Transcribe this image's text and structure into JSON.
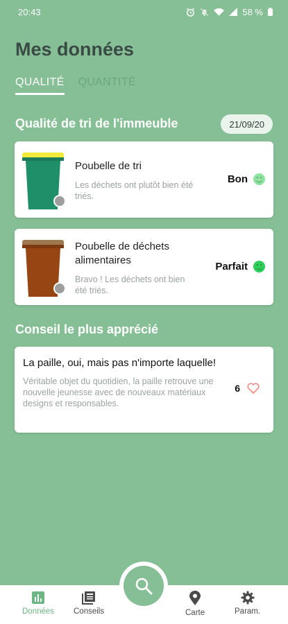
{
  "status_bar": {
    "time": "20:43",
    "battery": "58 %"
  },
  "header": {
    "title": "Mes données"
  },
  "tabs": [
    {
      "label": "QUALITÉ",
      "active": true
    },
    {
      "label": "QUANTITÉ",
      "active": false
    }
  ],
  "quality": {
    "title": "Qualité de tri de l'immeuble",
    "date": "21/09/20",
    "bins": [
      {
        "name": "Poubelle de tri",
        "description": "Les déchets ont plutôt bien été triés.",
        "rating": "Bon",
        "lid_color": "#f2ea3a",
        "body_color": "#1f8f6a",
        "face_color": "#8fe3a0"
      },
      {
        "name": "Poubelle de déchets alimentaires",
        "description": "Bravo ! Les déchets ont bien été triés.",
        "rating": "Parfait",
        "lid_color": "#a07850",
        "body_color": "#964513",
        "face_color": "#2ecc5a"
      }
    ]
  },
  "advice": {
    "title": "Conseil le plus apprécié",
    "tip_title": "La paille, oui, mais pas n'importe laquelle!",
    "tip_body": "Véritable objet du quotidien, la paille retrouve une nouvelle jeunesse avec de nouveaux matériaux designs et responsables.",
    "likes": "6",
    "heart_color": "#ef8a80"
  },
  "nav": {
    "items": [
      {
        "label": "Données",
        "icon": "bar-chart-icon",
        "active": true
      },
      {
        "label": "Conseils",
        "icon": "news-icon",
        "active": false
      },
      {
        "label": "Carte",
        "icon": "map-pin-icon",
        "active": false
      },
      {
        "label": "Param.",
        "icon": "gear-icon",
        "active": false
      }
    ],
    "fab_icon": "search-icon"
  },
  "colors": {
    "background": "#86bf95",
    "accent": "#6db584"
  }
}
